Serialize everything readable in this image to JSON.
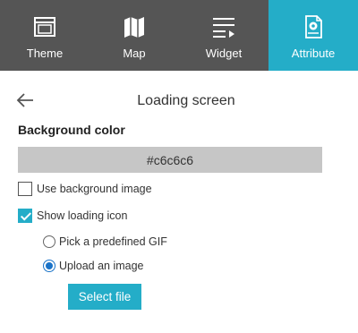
{
  "tabs": [
    {
      "label": "Theme",
      "icon": "theme-icon",
      "active": false
    },
    {
      "label": "Map",
      "icon": "map-icon",
      "active": false
    },
    {
      "label": "Widget",
      "icon": "widget-icon",
      "active": false
    },
    {
      "label": "Attribute",
      "icon": "attribute-icon",
      "active": true
    }
  ],
  "header": {
    "title": "Loading screen"
  },
  "background": {
    "label": "Background color",
    "color_value": "#c6c6c6"
  },
  "options": {
    "use_background_image": {
      "label": "Use background image",
      "checked": false
    },
    "show_loading_icon": {
      "label": "Show loading icon",
      "checked": true
    },
    "predefined_gif": {
      "label": "Pick a predefined GIF",
      "selected": false
    },
    "upload_image": {
      "label": "Upload an image",
      "selected": true
    }
  },
  "select_file_label": "Select file",
  "colors": {
    "tabbar_bg": "#555555",
    "accent": "#24adc8",
    "radio_accent": "#1a73c8"
  }
}
